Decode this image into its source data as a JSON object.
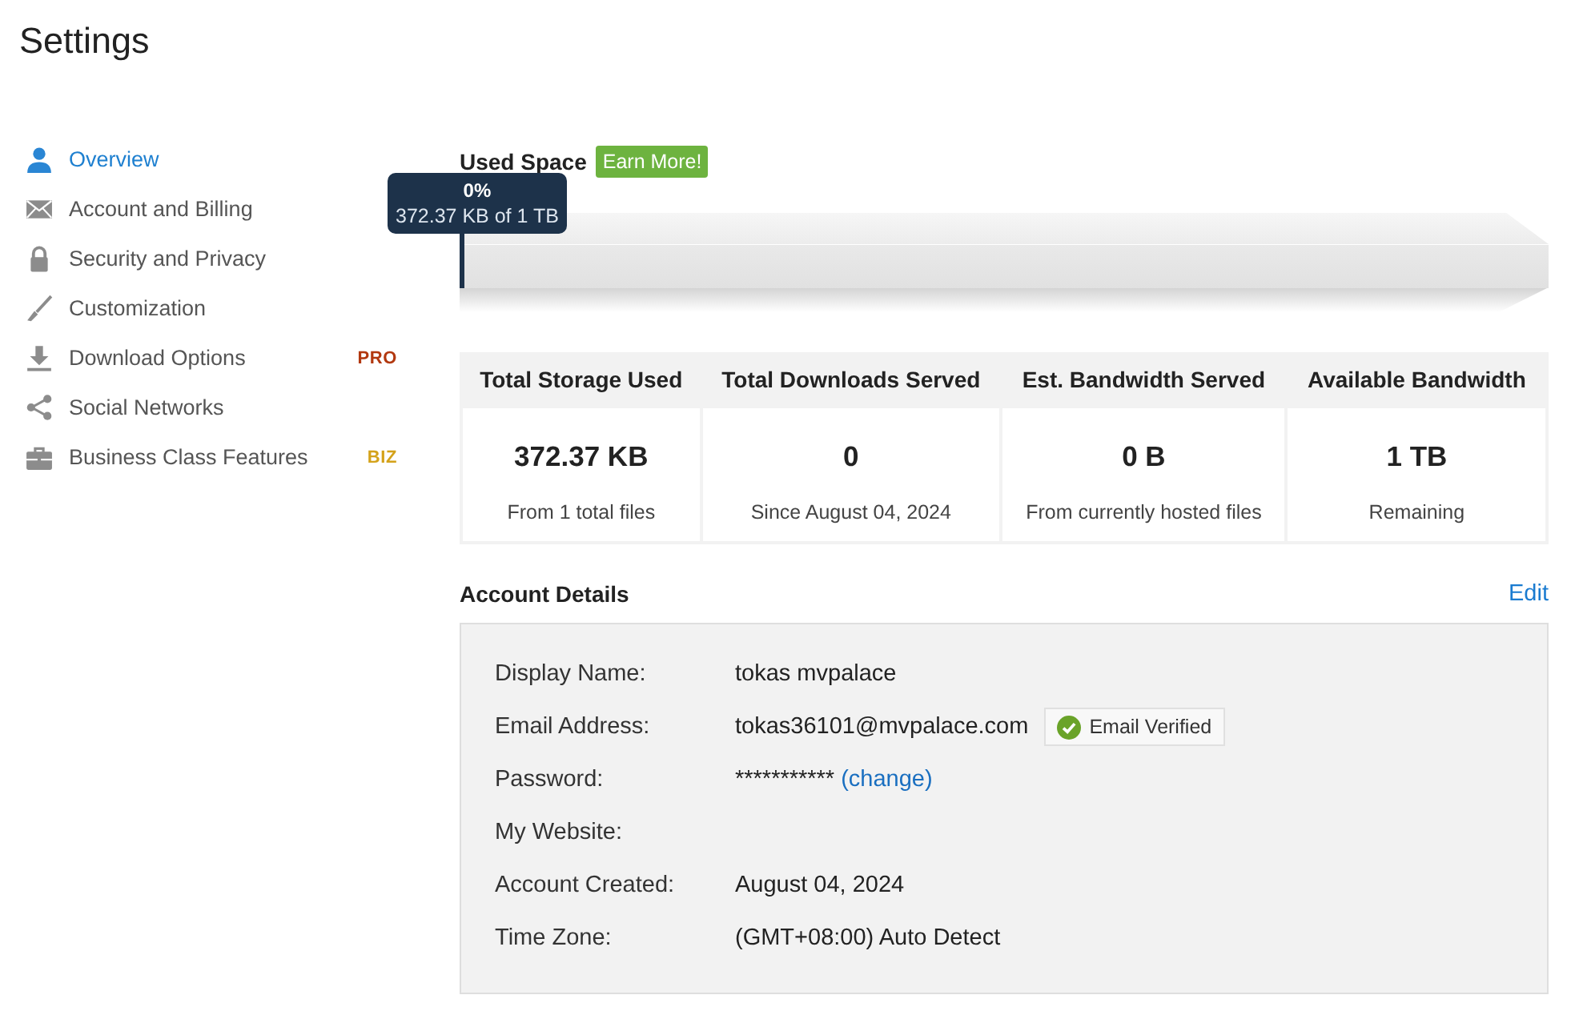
{
  "page": {
    "title": "Settings"
  },
  "sidebar": {
    "items": [
      {
        "label": "Overview",
        "selected": true
      },
      {
        "label": "Account and Billing",
        "selected": false
      },
      {
        "label": "Security and Privacy",
        "selected": false
      },
      {
        "label": "Customization",
        "selected": false
      },
      {
        "label": "Download Options",
        "selected": false,
        "badge": {
          "text": "PRO",
          "color": "#b2380f"
        }
      },
      {
        "label": "Social Networks",
        "selected": false
      },
      {
        "label": "Business Class Features",
        "selected": false,
        "badge": {
          "text": "BIZ",
          "color": "#d4a21a"
        }
      }
    ]
  },
  "used_space": {
    "title": "Used Space",
    "badge": "Earn More!",
    "level": 0,
    "tooltip": {
      "percent": "0%",
      "detail": "372.37 KB of 1 TB"
    }
  },
  "stats": [
    {
      "heading": "Total Storage Used",
      "value": "372.37 KB",
      "note": "From 1 total files"
    },
    {
      "heading": "Total Downloads Served",
      "value": "0",
      "note": "Since August 04, 2024"
    },
    {
      "heading": "Est. Bandwidth Served",
      "value": "0 B",
      "note": "From currently hosted files"
    },
    {
      "heading": "Available Bandwidth",
      "value": "1 TB",
      "note": "Remaining"
    }
  ],
  "account_details": {
    "title": "Account Details",
    "edit": "Edit",
    "rows": [
      {
        "label": "Display Name:",
        "value": "tokas mvpalace"
      },
      {
        "label": "Email Address:",
        "value": "tokas36101@mvpalace.com",
        "badge": "Email Verified"
      },
      {
        "label": "Password:",
        "value": "***********",
        "link": "(change)"
      },
      {
        "label": "My Website:"
      },
      {
        "label": "Account Created:",
        "value": "August 04, 2024"
      },
      {
        "label": "Time Zone:",
        "value": "(GMT+08:00) Auto Detect"
      }
    ]
  }
}
